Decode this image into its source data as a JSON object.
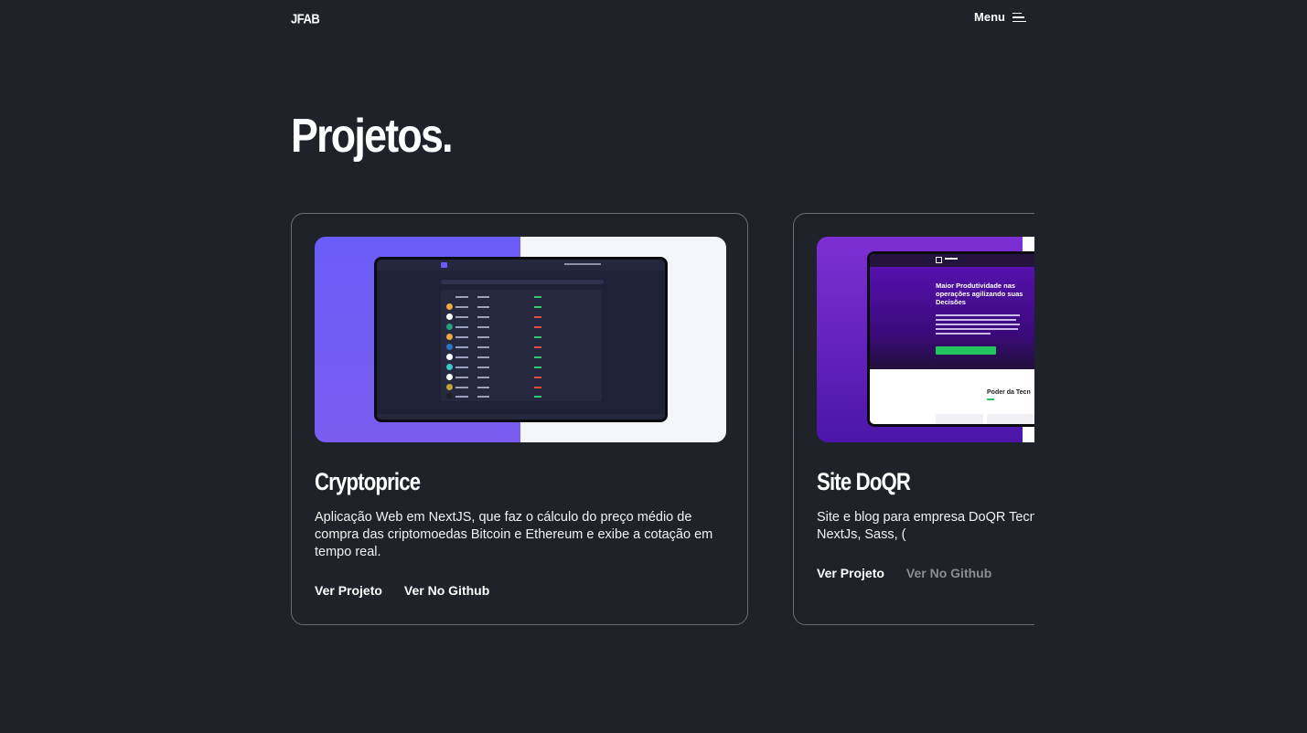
{
  "header": {
    "logo": "JFAB",
    "menu_label": "Menu"
  },
  "page_title": "Projetos.",
  "projects": [
    {
      "title": "Cryptoprice",
      "description": "Aplicação Web em NextJS, que faz o cálculo do preço médio de compra das criptomoedas Bitcoin e Ethereum e exibe a cotação em tempo real.",
      "link_project": "Ver Projeto",
      "link_github": "Ver No Github",
      "colors": {
        "thumb_left": "#6b5cf7",
        "thumb_right": "#f4f5fb"
      }
    },
    {
      "title": "Site DoQR",
      "description": "Site e blog para empresa DoQR Tecno por um CMS. Utilizado NextJs, Sass, (",
      "link_project": "Ver Projeto",
      "link_github": "Ver No Github",
      "thumb_heading": "Maior Produtividade nas operações agilizando suas Decisões",
      "thumb_section": "Poder da Tecn",
      "colors": {
        "thumb_left": "#7e2fd4",
        "thumb_right": "#ffffff"
      }
    }
  ]
}
